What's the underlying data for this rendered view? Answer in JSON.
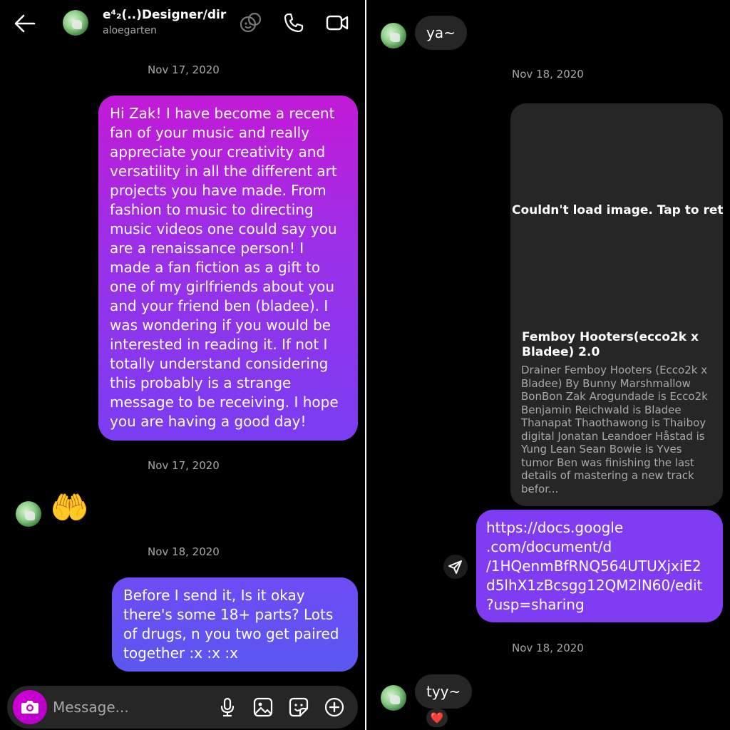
{
  "left": {
    "header": {
      "name": "e⁴₂(..)Designer/dir",
      "username": "aloegarten"
    },
    "dates": [
      "Nov 17, 2020",
      "Nov 17, 2020",
      "Nov 18, 2020"
    ],
    "messages": {
      "first": "Hi Zak! I have become a recent fan of your music and really appreciate your creativity and versatility in all the different art projects you have made. From fashion to music to directing music videos one could say you are a renaissance person! I made a fan fiction as a gift to one of my girlfriends about you and your friend ben (bladee). I was wondering if you would be interested in reading it. If not I totally understand considering this probably is a strange message to be receiving. I hope you are having a good day!",
      "emoji": "🤲",
      "second": "Before I send it, Is it okay there's some 18+ parts? Lots of drugs, n you two get paired together :x :x :x"
    },
    "composer": {
      "placeholder": "Message..."
    }
  },
  "right": {
    "messages": {
      "ya": "ya~",
      "link_url": "https://docs.google .com/document/d /1HQenmBfRNQ564UTUXjxiE2 d5lhX1zBcsgg12QM2lN60/edit ?usp=sharing",
      "tyy": "tyy~",
      "reaction": "❤️"
    },
    "dates": [
      "Nov 18, 2020",
      "Nov 18, 2020"
    ],
    "link_card": {
      "image_error": "Couldn't load image. Tap to retry.",
      "title": "Femboy Hooters(ecco2k x Bladee) 2.0",
      "description": "Drainer Femboy Hooters (Ecco2k x Bladee) By Bunny Marshmallow BonBon Zak Arogundade is Ecco2k Benjamin Reichwald is Bladee Thanapat Thaothawong is Thaiboy digital Jonatan Leandoer Håstad is Yung Lean Sean Bowie is Yves tumor Ben was finishing the last details of mastering a new track befor..."
    }
  },
  "icons": {
    "back": "arrow-left-icon",
    "effects": "effects-icon",
    "call": "phone-icon",
    "video": "video-camera-icon",
    "camera": "camera-icon",
    "mic": "microphone-icon",
    "gallery": "image-icon",
    "sticker": "sticker-icon",
    "plus": "plus-circle-icon",
    "share": "send-icon"
  },
  "colors": {
    "background": "#000000",
    "incoming_bubble": "#262626",
    "outgoing_gradient_top": "#c21ad6",
    "outgoing_gradient_bottom": "#7a3df2",
    "outgoing_blue": "#5b57f0",
    "camera_button": "#d400d6",
    "muted_text": "#a8a8a8"
  }
}
